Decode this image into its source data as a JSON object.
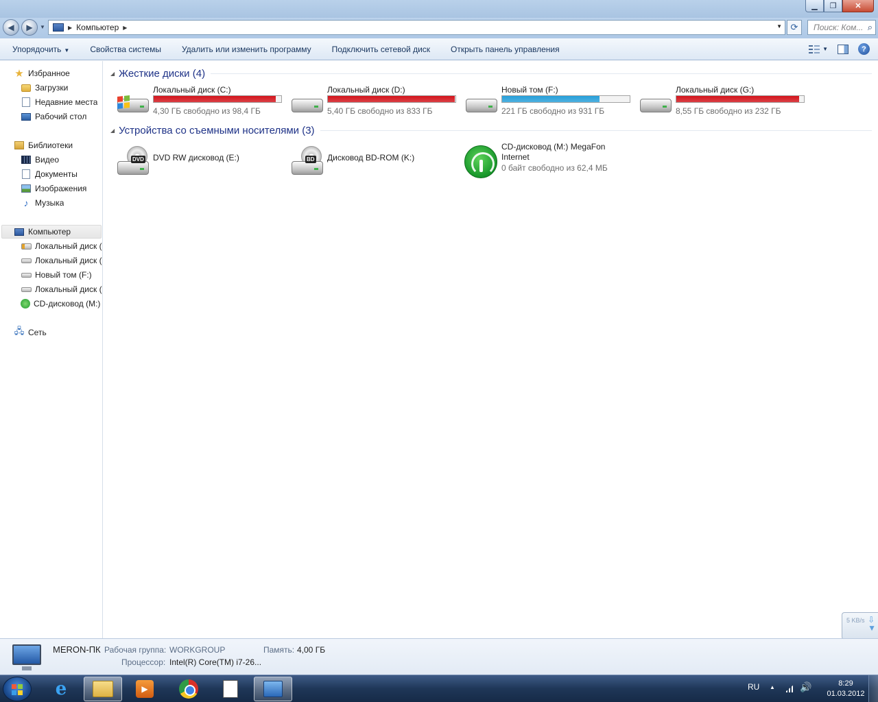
{
  "window": {
    "caption_buttons": {
      "minimize": "▁",
      "maximize": "❐",
      "close": "✕"
    }
  },
  "nav": {
    "back_icon": "back-arrow-icon",
    "forward_icon": "forward-arrow-icon",
    "breadcrumb": [
      "Компьютер"
    ],
    "search_placeholder": "Поиск: Ком..."
  },
  "commandbar": {
    "items": [
      "Упорядочить",
      "Свойства системы",
      "Удалить или изменить программу",
      "Подключить сетевой диск",
      "Открыть панель управления"
    ]
  },
  "sidebar": {
    "favorites": {
      "label": "Избранное",
      "items": [
        "Загрузки",
        "Недавние места",
        "Рабочий стол"
      ]
    },
    "libraries": {
      "label": "Библиотеки",
      "items": [
        "Видео",
        "Документы",
        "Изображения",
        "Музыка"
      ]
    },
    "computer": {
      "label": "Компьютер",
      "items": [
        "Локальный диск (",
        "Локальный диск (",
        "Новый том (F:)",
        "Локальный диск (",
        "CD-дисковод (M:)"
      ]
    },
    "network": {
      "label": "Сеть"
    }
  },
  "groups": {
    "hdd": {
      "title": "Жесткие диски (4)",
      "drives": [
        {
          "name": "Локальный диск (C:)",
          "free": "4,30 ГБ свободно из 98,4 ГБ",
          "used_fraction": 0.956,
          "bar_color": "#d4141b"
        },
        {
          "name": "Локальный диск (D:)",
          "free": "5,40 ГБ свободно из 833 ГБ",
          "used_fraction": 0.994,
          "bar_color": "#d4141b"
        },
        {
          "name": "Новый том (F:)",
          "free": "221 ГБ свободно из 931 ГБ",
          "used_fraction": 0.762,
          "bar_color": "#26a0da"
        },
        {
          "name": "Локальный диск (G:)",
          "free": "8,55 ГБ свободно из 232 ГБ",
          "used_fraction": 0.963,
          "bar_color": "#d4141b"
        }
      ]
    },
    "removable": {
      "title": "Устройства со съемными носителями (3)",
      "devices": [
        {
          "name": "DVD RW дисковод (E:)",
          "badge": "DVD"
        },
        {
          "name": "Дисковод BD-ROM (K:)",
          "badge": "BD"
        },
        {
          "name": "CD-дисковод (M:) MegaFon",
          "name2": "Internet",
          "free": "0 байт свободно из 62,4 МБ"
        }
      ]
    }
  },
  "details": {
    "computer_name": "MERON-ПК",
    "workgroup_label": "Рабочая группа:",
    "workgroup_value": "WORKGROUP",
    "memory_label": "Память:",
    "memory_value": "4,00 ГБ",
    "cpu_label": "Процессор:",
    "cpu_value": "Intel(R) Core(TM) i7-26..."
  },
  "gadget": {
    "speed": "5 KB/s"
  },
  "taskbar": {
    "apps": [
      "internet-explorer",
      "windows-explorer",
      "media-player",
      "chrome",
      "notepad-document",
      "network-manager"
    ],
    "language": "RU",
    "time": "8:29",
    "date": "01.03.2012"
  }
}
